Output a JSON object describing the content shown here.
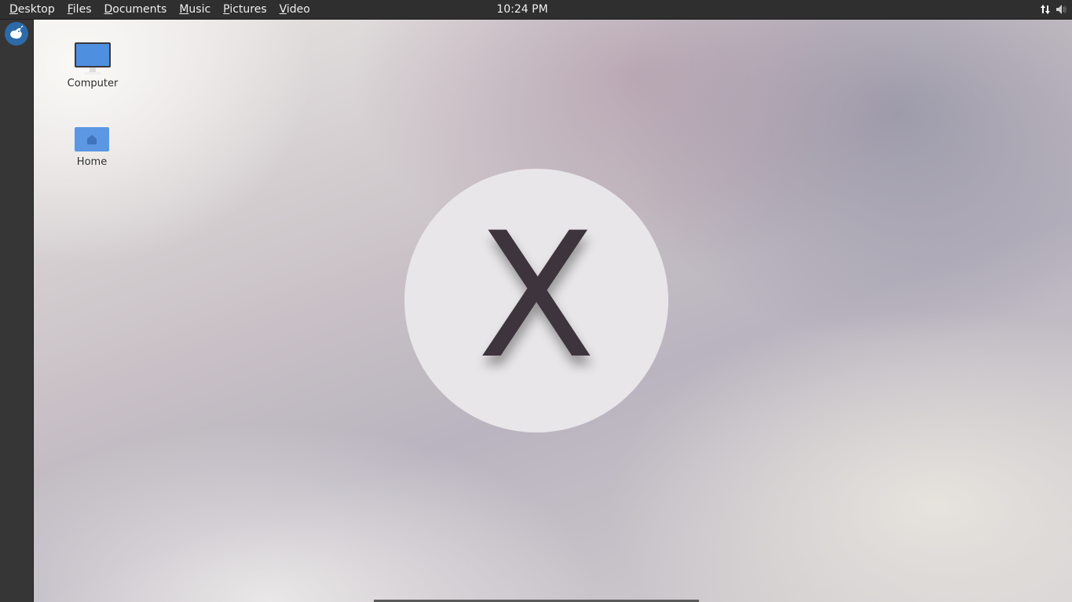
{
  "top_panel": {
    "menu": [
      {
        "mnemonic": "D",
        "rest": "esktop"
      },
      {
        "mnemonic": "F",
        "rest": "iles"
      },
      {
        "mnemonic": "D",
        "rest": "ocuments"
      },
      {
        "mnemonic": "M",
        "rest": "usic"
      },
      {
        "mnemonic": "P",
        "rest": "ictures"
      },
      {
        "mnemonic": "V",
        "rest": "ideo"
      }
    ],
    "clock": "10:24 PM",
    "tray_icons": [
      "network-transfer-icon",
      "volume-icon"
    ]
  },
  "dock": {
    "launcher_icon": "app-launcher-icon"
  },
  "desktop": {
    "icons": [
      {
        "name": "computer-icon",
        "label": "Computer"
      },
      {
        "name": "home-folder-icon",
        "label": "Home"
      }
    ],
    "logo_letter": "X"
  },
  "colors": {
    "panel": "#2f2f2f",
    "dock": "#363636",
    "launcher": "#2c6aa8",
    "icon_blue": "#4f8fe0",
    "logo_circle": "#e8e6e8",
    "logo_letter": "#3e343d"
  }
}
